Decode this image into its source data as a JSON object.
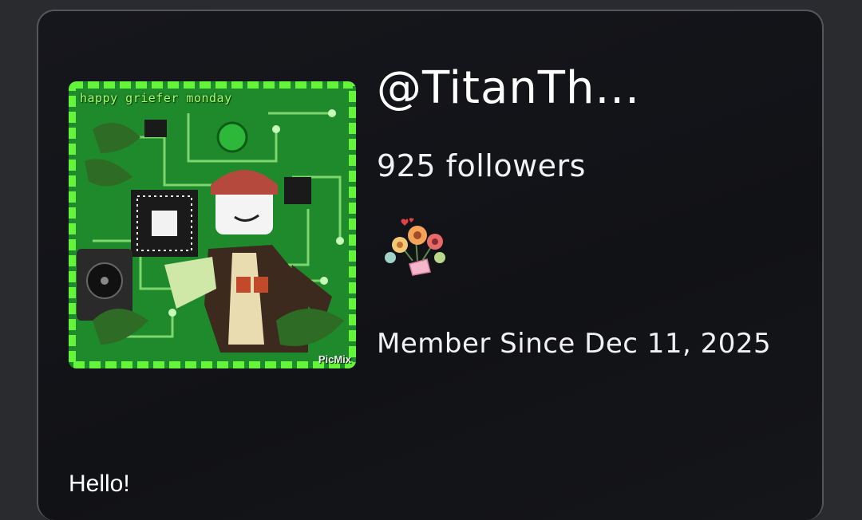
{
  "profile": {
    "username": "@TitanTh...",
    "followers_text": "925 followers",
    "member_since_text": "Member Since Dec 11, 2025",
    "bio": "Hello!",
    "avatar": {
      "caption": "happy griefer monday",
      "watermark": "PicMix",
      "icon": "avatar-image"
    },
    "sticker_icon": "flower-bouquet-icon"
  },
  "colors": {
    "background": "#2a2b2f",
    "card": "#131418",
    "text": "#ffffff",
    "avatar_green": "#1e7a2a"
  }
}
